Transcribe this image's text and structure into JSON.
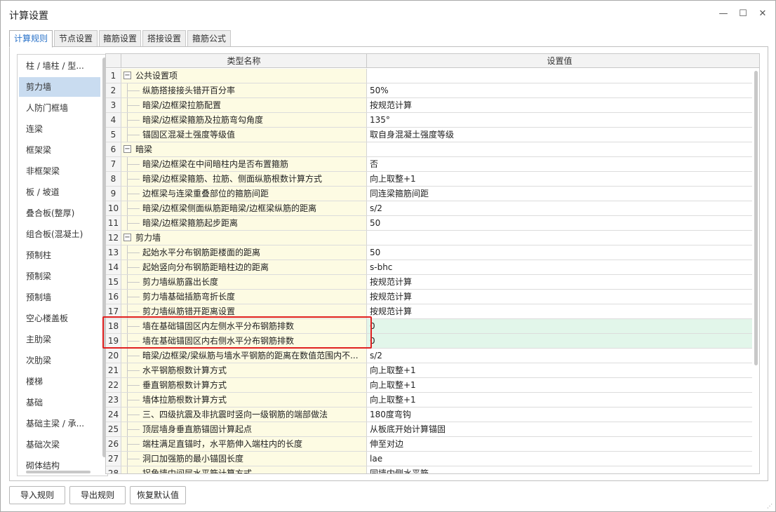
{
  "window": {
    "title": "计算设置"
  },
  "tabs": [
    {
      "label": "计算规则",
      "active": true
    },
    {
      "label": "节点设置",
      "active": false
    },
    {
      "label": "箍筋设置",
      "active": false
    },
    {
      "label": "搭接设置",
      "active": false
    },
    {
      "label": "箍筋公式",
      "active": false
    }
  ],
  "sidebar": {
    "selected": "剪力墙",
    "items": [
      "柱 / 墙柱 / 型...",
      "剪力墙",
      "人防门框墙",
      "连梁",
      "框架梁",
      "非框架梁",
      "板 / 坡道",
      "叠合板(整厚)",
      "组合板(混凝土)",
      "预制柱",
      "预制梁",
      "预制墙",
      "空心楼盖板",
      "主肋梁",
      "次肋梁",
      "楼梯",
      "基础",
      "基础主梁 / 承...",
      "基础次梁",
      "砌体结构"
    ]
  },
  "grid": {
    "headers": {
      "name": "类型名称",
      "value": "设置值"
    },
    "rows": [
      {
        "num": "1",
        "name": "公共设置项",
        "value": "",
        "group": true
      },
      {
        "num": "2",
        "name": "纵筋搭接接头错开百分率",
        "value": "50%"
      },
      {
        "num": "3",
        "name": "暗梁/边框梁拉筋配置",
        "value": "按规范计算"
      },
      {
        "num": "4",
        "name": "暗梁/边框梁箍筋及拉筋弯勾角度",
        "value": "135°"
      },
      {
        "num": "5",
        "name": "锚固区混凝土强度等级值",
        "value": "取自身混凝土强度等级"
      },
      {
        "num": "6",
        "name": "暗梁",
        "value": "",
        "group": true
      },
      {
        "num": "7",
        "name": "暗梁/边框梁在中间暗柱内是否布置箍筋",
        "value": "否"
      },
      {
        "num": "8",
        "name": "暗梁/边框梁箍筋、拉筋、侧面纵筋根数计算方式",
        "value": "向上取整+1"
      },
      {
        "num": "9",
        "name": "边框梁与连梁重叠部位的箍筋间距",
        "value": "同连梁箍筋间距"
      },
      {
        "num": "10",
        "name": "暗梁/边框梁侧面纵筋距暗梁/边框梁纵筋的距离",
        "value": "s/2"
      },
      {
        "num": "11",
        "name": "暗梁/边框梁箍筋起步距离",
        "value": "50"
      },
      {
        "num": "12",
        "name": "剪力墙",
        "value": "",
        "group": true
      },
      {
        "num": "13",
        "name": "起始水平分布钢筋距楼面的距离",
        "value": "50"
      },
      {
        "num": "14",
        "name": "起始竖向分布钢筋距暗柱边的距离",
        "value": "s-bhc"
      },
      {
        "num": "15",
        "name": "剪力墙纵筋露出长度",
        "value": "按规范计算"
      },
      {
        "num": "16",
        "name": "剪力墙基础插筋弯折长度",
        "value": "按规范计算"
      },
      {
        "num": "17",
        "name": "剪力墙纵筋错开距离设置",
        "value": "按规范计算"
      },
      {
        "num": "18",
        "name": "墙在基础锚固区内左侧水平分布钢筋排数",
        "value": "0",
        "highlight": true
      },
      {
        "num": "19",
        "name": "墙在基础锚固区内右侧水平分布钢筋排数",
        "value": "0",
        "highlight": true
      },
      {
        "num": "20",
        "name": "暗梁/边框梁/梁纵筋与墙水平钢筋的距离在数值范围内不...",
        "value": "s/2"
      },
      {
        "num": "21",
        "name": "水平钢筋根数计算方式",
        "value": "向上取整+1"
      },
      {
        "num": "22",
        "name": "垂直钢筋根数计算方式",
        "value": "向上取整+1"
      },
      {
        "num": "23",
        "name": "墙体拉筋根数计算方式",
        "value": "向上取整+1"
      },
      {
        "num": "24",
        "name": "三、四级抗震及非抗震时竖向一级钢筋的端部做法",
        "value": "180度弯钩"
      },
      {
        "num": "25",
        "name": "顶层墙身垂直筋锚固计算起点",
        "value": "从板底开始计算锚固"
      },
      {
        "num": "26",
        "name": "端柱满足直锚时，水平筋伸入端柱内的长度",
        "value": "伸至对边"
      },
      {
        "num": "27",
        "name": "洞口加强筋的最小锚固长度",
        "value": "lae"
      },
      {
        "num": "28",
        "name": "拐角墙中间层水平筋计算方式",
        "value": "同墙内侧水平筋"
      }
    ]
  },
  "buttons": {
    "import": "导入规则",
    "export": "导出规则",
    "restore": "恢复默认值"
  },
  "colors": {
    "accent": "#2a73c9",
    "highlight_row": "#e2f6ea",
    "name_cell": "#fdfbe3",
    "annotation_box": "#e02020"
  }
}
